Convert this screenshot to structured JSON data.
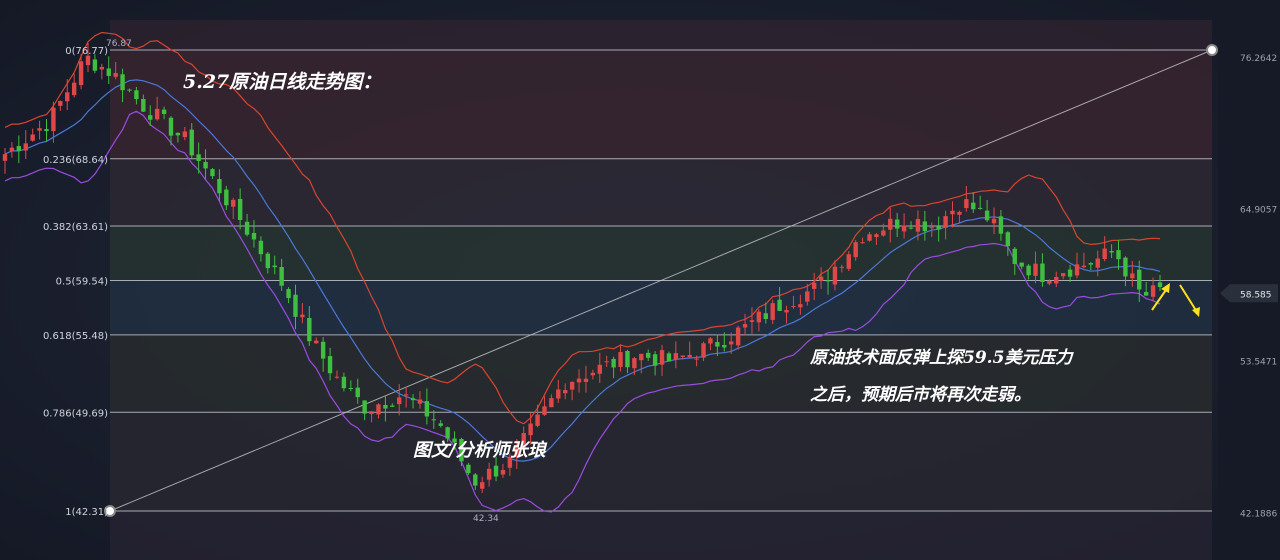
{
  "chart_data": {
    "type": "candlestick",
    "title": "5.27原油日线走势图：",
    "fib_levels": [
      {
        "label": "0(76.77)",
        "price": 76.77
      },
      {
        "label": "0.236(68.64)",
        "price": 68.64
      },
      {
        "label": "0.382(63.61)",
        "price": 63.61
      },
      {
        "label": "0.5(59.54)",
        "price": 59.54
      },
      {
        "label": "0.618(55.48)",
        "price": 55.48
      },
      {
        "label": "0.786(49.69)",
        "price": 49.69
      },
      {
        "label": "1(42.31)",
        "price": 42.31
      }
    ],
    "right_axis_labels": [
      "76.2642",
      "64.9057",
      "53.5471",
      "42.1886"
    ],
    "current_price": "58.585",
    "marker_labels": {
      "high": "76.87",
      "low": "42.34"
    },
    "annotations": {
      "analysis_line1": "原油技术面反弹上探59.5美元压力",
      "analysis_line2": "之后，预期后市将再次走弱。",
      "author": "图文/分析师张琅"
    },
    "y_range": [
      38,
      80
    ],
    "colors": {
      "up": "#e04848",
      "down": "#3fbf3f",
      "upper_band": "#d8452f",
      "middle_band": "#4a78d8",
      "lower_band": "#9a4ce0",
      "arrow": "#ffe21a"
    }
  }
}
